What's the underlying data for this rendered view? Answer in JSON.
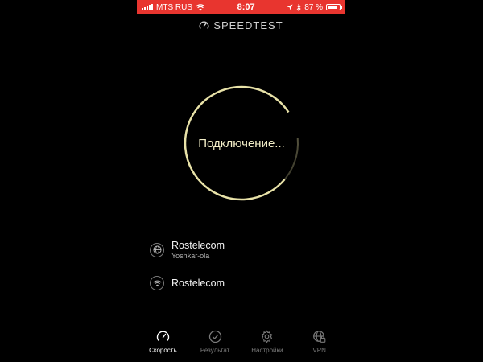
{
  "status_bar": {
    "carrier": "MTS RUS",
    "time": "8:07",
    "battery_text": "87 %",
    "battery_level": 0.87,
    "background": "#e8352f"
  },
  "header": {
    "app_name": "SPEEDTEST",
    "icon": "speedometer-icon"
  },
  "gauge": {
    "status_text": "Подключение...",
    "ring_color": "#e8e2a8"
  },
  "servers": [
    {
      "icon": "globe-icon",
      "name": "Rostelecom",
      "location": "Yoshkar-ola"
    },
    {
      "icon": "wifi-icon",
      "name": "Rostelecom",
      "location": ""
    }
  ],
  "tabs": [
    {
      "icon": "speedometer-icon",
      "label": "Скорость",
      "active": true
    },
    {
      "icon": "check-circle-icon",
      "label": "Результат",
      "active": false
    },
    {
      "icon": "gear-icon",
      "label": "Настройки",
      "active": false
    },
    {
      "icon": "globe-lock-icon",
      "label": "VPN",
      "active": false
    }
  ]
}
